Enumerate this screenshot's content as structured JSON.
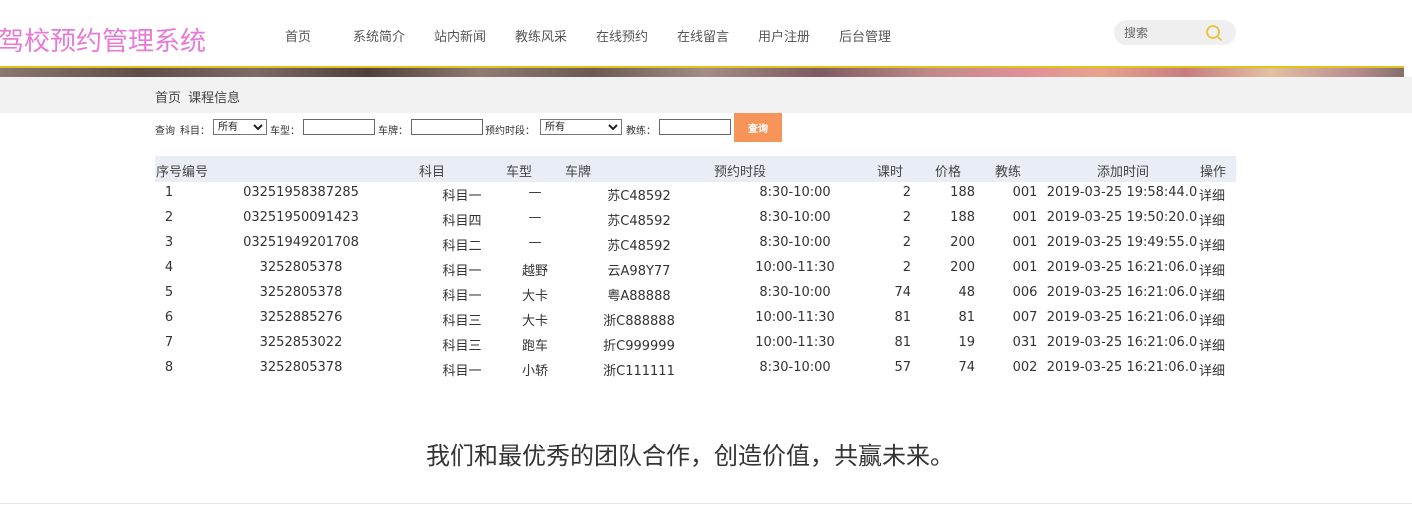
{
  "header": {
    "logo": "驾校预约管理系统",
    "nav": [
      "首页",
      "系统简介",
      "站内新闻",
      "教练风采",
      "在线预约",
      "在线留言",
      "用户注册",
      "后台管理"
    ],
    "search_placeholder": "搜索"
  },
  "breadcrumb": [
    "首页",
    "课程信息"
  ],
  "filter": {
    "query_label": "查询",
    "subject_label": "科目：",
    "subject_value": "所有",
    "cartype_label": "车型：",
    "plate_label": "车牌：",
    "slot_label": "预约时段：",
    "slot_value": "所有",
    "coach_label": "教练：",
    "button": "查询"
  },
  "table": {
    "headers": [
      "序号编号",
      "科目",
      "车型",
      "车牌",
      "预约时段",
      "课时",
      "价格",
      "教练",
      "添加时间",
      "操作"
    ],
    "rows": [
      {
        "idx": "1",
        "code": "03251958387285",
        "subject": "科目一",
        "cartype": "—",
        "plate": "苏C48592",
        "slot": "8:30-10:00",
        "hours": "2",
        "price": "188",
        "coach": "001",
        "time": "2019-03-25 19:58:44.0",
        "op": "详细"
      },
      {
        "idx": "2",
        "code": "03251950091423",
        "subject": "科目四",
        "cartype": "—",
        "plate": "苏C48592",
        "slot": "8:30-10:00",
        "hours": "2",
        "price": "188",
        "coach": "001",
        "time": "2019-03-25 19:50:20.0",
        "op": "详细"
      },
      {
        "idx": "3",
        "code": "03251949201708",
        "subject": "科目二",
        "cartype": "—",
        "plate": "苏C48592",
        "slot": "8:30-10:00",
        "hours": "2",
        "price": "200",
        "coach": "001",
        "time": "2019-03-25 19:49:55.0",
        "op": "详细"
      },
      {
        "idx": "4",
        "code": "3252805378",
        "subject": "科目一",
        "cartype": "越野",
        "plate": "云A98Y77",
        "slot": "10:00-11:30",
        "hours": "2",
        "price": "200",
        "coach": "001",
        "time": "2019-03-25 16:21:06.0",
        "op": "详细"
      },
      {
        "idx": "5",
        "code": "3252805378",
        "subject": "科目一",
        "cartype": "大卡",
        "plate": "粤A88888",
        "slot": "8:30-10:00",
        "hours": "74",
        "price": "48",
        "coach": "006",
        "time": "2019-03-25 16:21:06.0",
        "op": "详细"
      },
      {
        "idx": "6",
        "code": "3252885276",
        "subject": "科目三",
        "cartype": "大卡",
        "plate": "浙C888888",
        "slot": "10:00-11:30",
        "hours": "81",
        "price": "81",
        "coach": "007",
        "time": "2019-03-25 16:21:06.0",
        "op": "详细"
      },
      {
        "idx": "7",
        "code": "3252853022",
        "subject": "科目三",
        "cartype": "跑车",
        "plate": "折C999999",
        "slot": "10:00-11:30",
        "hours": "81",
        "price": "19",
        "coach": "031",
        "time": "2019-03-25 16:21:06.0",
        "op": "详细"
      },
      {
        "idx": "8",
        "code": "3252805378",
        "subject": "科目一",
        "cartype": "小轿",
        "plate": "浙C111111",
        "slot": "8:30-10:00",
        "hours": "57",
        "price": "74",
        "coach": "002",
        "time": "2019-03-25 16:21:06.0",
        "op": "详细"
      }
    ]
  },
  "slogan": "我们和最优秀的团队合作，创造价值，共赢未来。",
  "colors": {
    "logo": "#e879d6",
    "accent_button": "#f7945a",
    "table_header_bg": "#e9eef6",
    "banner_line": "#e5c21a"
  }
}
